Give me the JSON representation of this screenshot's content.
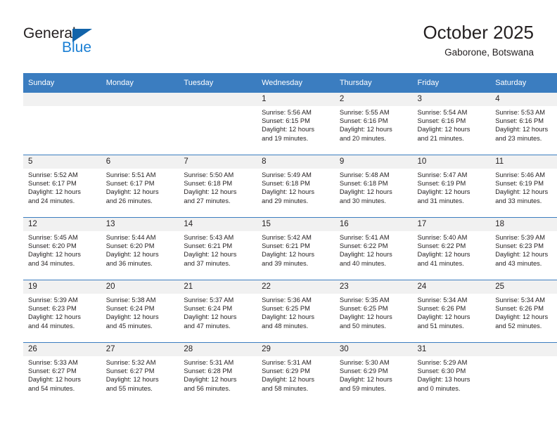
{
  "brand": {
    "name_top": "General",
    "name_bottom": "Blue",
    "accent_color": "#1a7fd4",
    "triangle_color": "#1264aa"
  },
  "header": {
    "month_title": "October 2025",
    "location": "Gaborone, Botswana"
  },
  "calendar": {
    "header_bg": "#3b7dc0",
    "daynum_bg": "#f1f1f1",
    "weekday_headers": [
      "Sunday",
      "Monday",
      "Tuesday",
      "Wednesday",
      "Thursday",
      "Friday",
      "Saturday"
    ],
    "weeks": [
      [
        {
          "day": "",
          "sunrise": "",
          "sunset": "",
          "daylight_1": "",
          "daylight_2": ""
        },
        {
          "day": "",
          "sunrise": "",
          "sunset": "",
          "daylight_1": "",
          "daylight_2": ""
        },
        {
          "day": "",
          "sunrise": "",
          "sunset": "",
          "daylight_1": "",
          "daylight_2": ""
        },
        {
          "day": "1",
          "sunrise": "Sunrise: 5:56 AM",
          "sunset": "Sunset: 6:15 PM",
          "daylight_1": "Daylight: 12 hours",
          "daylight_2": "and 19 minutes."
        },
        {
          "day": "2",
          "sunrise": "Sunrise: 5:55 AM",
          "sunset": "Sunset: 6:16 PM",
          "daylight_1": "Daylight: 12 hours",
          "daylight_2": "and 20 minutes."
        },
        {
          "day": "3",
          "sunrise": "Sunrise: 5:54 AM",
          "sunset": "Sunset: 6:16 PM",
          "daylight_1": "Daylight: 12 hours",
          "daylight_2": "and 21 minutes."
        },
        {
          "day": "4",
          "sunrise": "Sunrise: 5:53 AM",
          "sunset": "Sunset: 6:16 PM",
          "daylight_1": "Daylight: 12 hours",
          "daylight_2": "and 23 minutes."
        }
      ],
      [
        {
          "day": "5",
          "sunrise": "Sunrise: 5:52 AM",
          "sunset": "Sunset: 6:17 PM",
          "daylight_1": "Daylight: 12 hours",
          "daylight_2": "and 24 minutes."
        },
        {
          "day": "6",
          "sunrise": "Sunrise: 5:51 AM",
          "sunset": "Sunset: 6:17 PM",
          "daylight_1": "Daylight: 12 hours",
          "daylight_2": "and 26 minutes."
        },
        {
          "day": "7",
          "sunrise": "Sunrise: 5:50 AM",
          "sunset": "Sunset: 6:18 PM",
          "daylight_1": "Daylight: 12 hours",
          "daylight_2": "and 27 minutes."
        },
        {
          "day": "8",
          "sunrise": "Sunrise: 5:49 AM",
          "sunset": "Sunset: 6:18 PM",
          "daylight_1": "Daylight: 12 hours",
          "daylight_2": "and 29 minutes."
        },
        {
          "day": "9",
          "sunrise": "Sunrise: 5:48 AM",
          "sunset": "Sunset: 6:18 PM",
          "daylight_1": "Daylight: 12 hours",
          "daylight_2": "and 30 minutes."
        },
        {
          "day": "10",
          "sunrise": "Sunrise: 5:47 AM",
          "sunset": "Sunset: 6:19 PM",
          "daylight_1": "Daylight: 12 hours",
          "daylight_2": "and 31 minutes."
        },
        {
          "day": "11",
          "sunrise": "Sunrise: 5:46 AM",
          "sunset": "Sunset: 6:19 PM",
          "daylight_1": "Daylight: 12 hours",
          "daylight_2": "and 33 minutes."
        }
      ],
      [
        {
          "day": "12",
          "sunrise": "Sunrise: 5:45 AM",
          "sunset": "Sunset: 6:20 PM",
          "daylight_1": "Daylight: 12 hours",
          "daylight_2": "and 34 minutes."
        },
        {
          "day": "13",
          "sunrise": "Sunrise: 5:44 AM",
          "sunset": "Sunset: 6:20 PM",
          "daylight_1": "Daylight: 12 hours",
          "daylight_2": "and 36 minutes."
        },
        {
          "day": "14",
          "sunrise": "Sunrise: 5:43 AM",
          "sunset": "Sunset: 6:21 PM",
          "daylight_1": "Daylight: 12 hours",
          "daylight_2": "and 37 minutes."
        },
        {
          "day": "15",
          "sunrise": "Sunrise: 5:42 AM",
          "sunset": "Sunset: 6:21 PM",
          "daylight_1": "Daylight: 12 hours",
          "daylight_2": "and 39 minutes."
        },
        {
          "day": "16",
          "sunrise": "Sunrise: 5:41 AM",
          "sunset": "Sunset: 6:22 PM",
          "daylight_1": "Daylight: 12 hours",
          "daylight_2": "and 40 minutes."
        },
        {
          "day": "17",
          "sunrise": "Sunrise: 5:40 AM",
          "sunset": "Sunset: 6:22 PM",
          "daylight_1": "Daylight: 12 hours",
          "daylight_2": "and 41 minutes."
        },
        {
          "day": "18",
          "sunrise": "Sunrise: 5:39 AM",
          "sunset": "Sunset: 6:23 PM",
          "daylight_1": "Daylight: 12 hours",
          "daylight_2": "and 43 minutes."
        }
      ],
      [
        {
          "day": "19",
          "sunrise": "Sunrise: 5:39 AM",
          "sunset": "Sunset: 6:23 PM",
          "daylight_1": "Daylight: 12 hours",
          "daylight_2": "and 44 minutes."
        },
        {
          "day": "20",
          "sunrise": "Sunrise: 5:38 AM",
          "sunset": "Sunset: 6:24 PM",
          "daylight_1": "Daylight: 12 hours",
          "daylight_2": "and 45 minutes."
        },
        {
          "day": "21",
          "sunrise": "Sunrise: 5:37 AM",
          "sunset": "Sunset: 6:24 PM",
          "daylight_1": "Daylight: 12 hours",
          "daylight_2": "and 47 minutes."
        },
        {
          "day": "22",
          "sunrise": "Sunrise: 5:36 AM",
          "sunset": "Sunset: 6:25 PM",
          "daylight_1": "Daylight: 12 hours",
          "daylight_2": "and 48 minutes."
        },
        {
          "day": "23",
          "sunrise": "Sunrise: 5:35 AM",
          "sunset": "Sunset: 6:25 PM",
          "daylight_1": "Daylight: 12 hours",
          "daylight_2": "and 50 minutes."
        },
        {
          "day": "24",
          "sunrise": "Sunrise: 5:34 AM",
          "sunset": "Sunset: 6:26 PM",
          "daylight_1": "Daylight: 12 hours",
          "daylight_2": "and 51 minutes."
        },
        {
          "day": "25",
          "sunrise": "Sunrise: 5:34 AM",
          "sunset": "Sunset: 6:26 PM",
          "daylight_1": "Daylight: 12 hours",
          "daylight_2": "and 52 minutes."
        }
      ],
      [
        {
          "day": "26",
          "sunrise": "Sunrise: 5:33 AM",
          "sunset": "Sunset: 6:27 PM",
          "daylight_1": "Daylight: 12 hours",
          "daylight_2": "and 54 minutes."
        },
        {
          "day": "27",
          "sunrise": "Sunrise: 5:32 AM",
          "sunset": "Sunset: 6:27 PM",
          "daylight_1": "Daylight: 12 hours",
          "daylight_2": "and 55 minutes."
        },
        {
          "day": "28",
          "sunrise": "Sunrise: 5:31 AM",
          "sunset": "Sunset: 6:28 PM",
          "daylight_1": "Daylight: 12 hours",
          "daylight_2": "and 56 minutes."
        },
        {
          "day": "29",
          "sunrise": "Sunrise: 5:31 AM",
          "sunset": "Sunset: 6:29 PM",
          "daylight_1": "Daylight: 12 hours",
          "daylight_2": "and 58 minutes."
        },
        {
          "day": "30",
          "sunrise": "Sunrise: 5:30 AM",
          "sunset": "Sunset: 6:29 PM",
          "daylight_1": "Daylight: 12 hours",
          "daylight_2": "and 59 minutes."
        },
        {
          "day": "31",
          "sunrise": "Sunrise: 5:29 AM",
          "sunset": "Sunset: 6:30 PM",
          "daylight_1": "Daylight: 13 hours",
          "daylight_2": "and 0 minutes."
        },
        {
          "day": "",
          "sunrise": "",
          "sunset": "",
          "daylight_1": "",
          "daylight_2": ""
        }
      ]
    ]
  }
}
